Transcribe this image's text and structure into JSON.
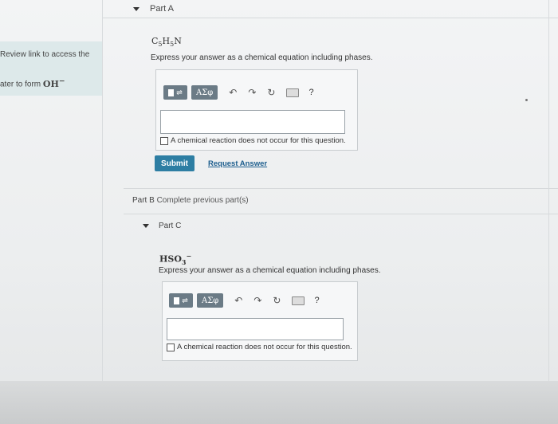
{
  "sidebar": {
    "review_link": "Review link to access the",
    "text_prefix": "ater to form ",
    "text_formula": "OH",
    "text_formula_sup": "−"
  },
  "part_a": {
    "title": "Part A",
    "formula_main": "C",
    "formula_sub1": "5",
    "formula_mid": "H",
    "formula_sub2": "5",
    "formula_end": "N",
    "instruction": "Express your answer as a chemical equation including phases.",
    "toolbar": {
      "greek_label": "ΑΣφ",
      "help_label": "?"
    },
    "checkbox_label": "A chemical reaction does not occur for this question.",
    "submit_label": "Submit",
    "request_label": "Request Answer"
  },
  "part_b": {
    "title": "Part B",
    "status": "Complete previous part(s)"
  },
  "part_c": {
    "title": "Part C",
    "formula_main": "HSO",
    "formula_sub": "3",
    "formula_sup": "−",
    "instruction": "Express your answer as a chemical equation including phases.",
    "toolbar": {
      "greek_label": "ΑΣφ",
      "help_label": "?"
    },
    "checkbox_label": "A chemical reaction does not occur for this question."
  },
  "icons": [
    "caret-down-icon",
    "templates-icon",
    "undo-icon",
    "redo-icon",
    "reset-icon",
    "keyboard-icon",
    "help-icon"
  ]
}
